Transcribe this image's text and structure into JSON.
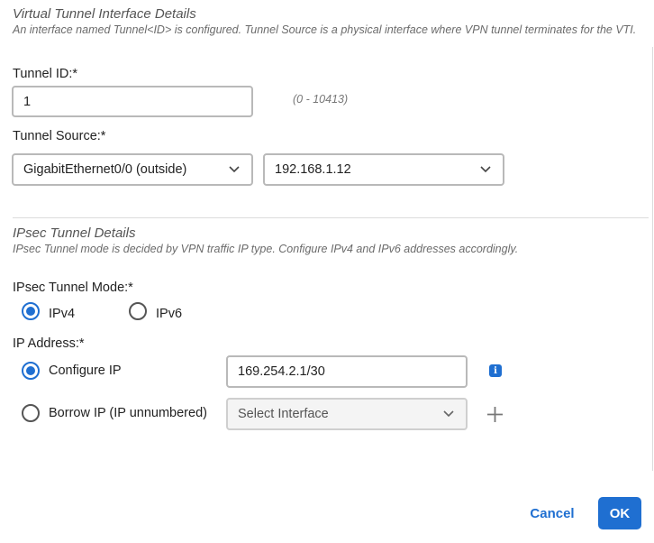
{
  "vti": {
    "title": "Virtual Tunnel Interface Details",
    "description": "An interface named Tunnel<ID> is configured. Tunnel Source is a physical interface where VPN tunnel terminates for the VTI.",
    "tunnel_id_label": "Tunnel ID:*",
    "tunnel_id_value": "1",
    "tunnel_id_hint": "(0 - 10413)",
    "tunnel_source_label": "Tunnel Source:*",
    "tunnel_source_interface": "GigabitEthernet0/0 (outside)",
    "tunnel_source_ip": "192.168.1.12"
  },
  "ipsec": {
    "title": "IPsec Tunnel Details",
    "description": "IPsec Tunnel mode is decided by VPN traffic IP type. Configure IPv4 and IPv6 addresses accordingly.",
    "mode_label": "IPsec Tunnel Mode:*",
    "mode_options": [
      {
        "label": "IPv4",
        "checked": true
      },
      {
        "label": "IPv6",
        "checked": false
      }
    ],
    "ip_address_label": "IP Address:*",
    "configure_ip_label": "Configure IP",
    "configure_ip_value": "169.254.2.1/30",
    "borrow_ip_label": "Borrow IP (IP unnumbered)",
    "select_interface_placeholder": "Select Interface"
  },
  "footer": {
    "cancel_label": "Cancel",
    "ok_label": "OK"
  },
  "colors": {
    "accent": "#1f6fd1"
  },
  "icons": {
    "chevron": "chevron-down-icon",
    "info": "info-icon",
    "add": "plus-icon"
  }
}
